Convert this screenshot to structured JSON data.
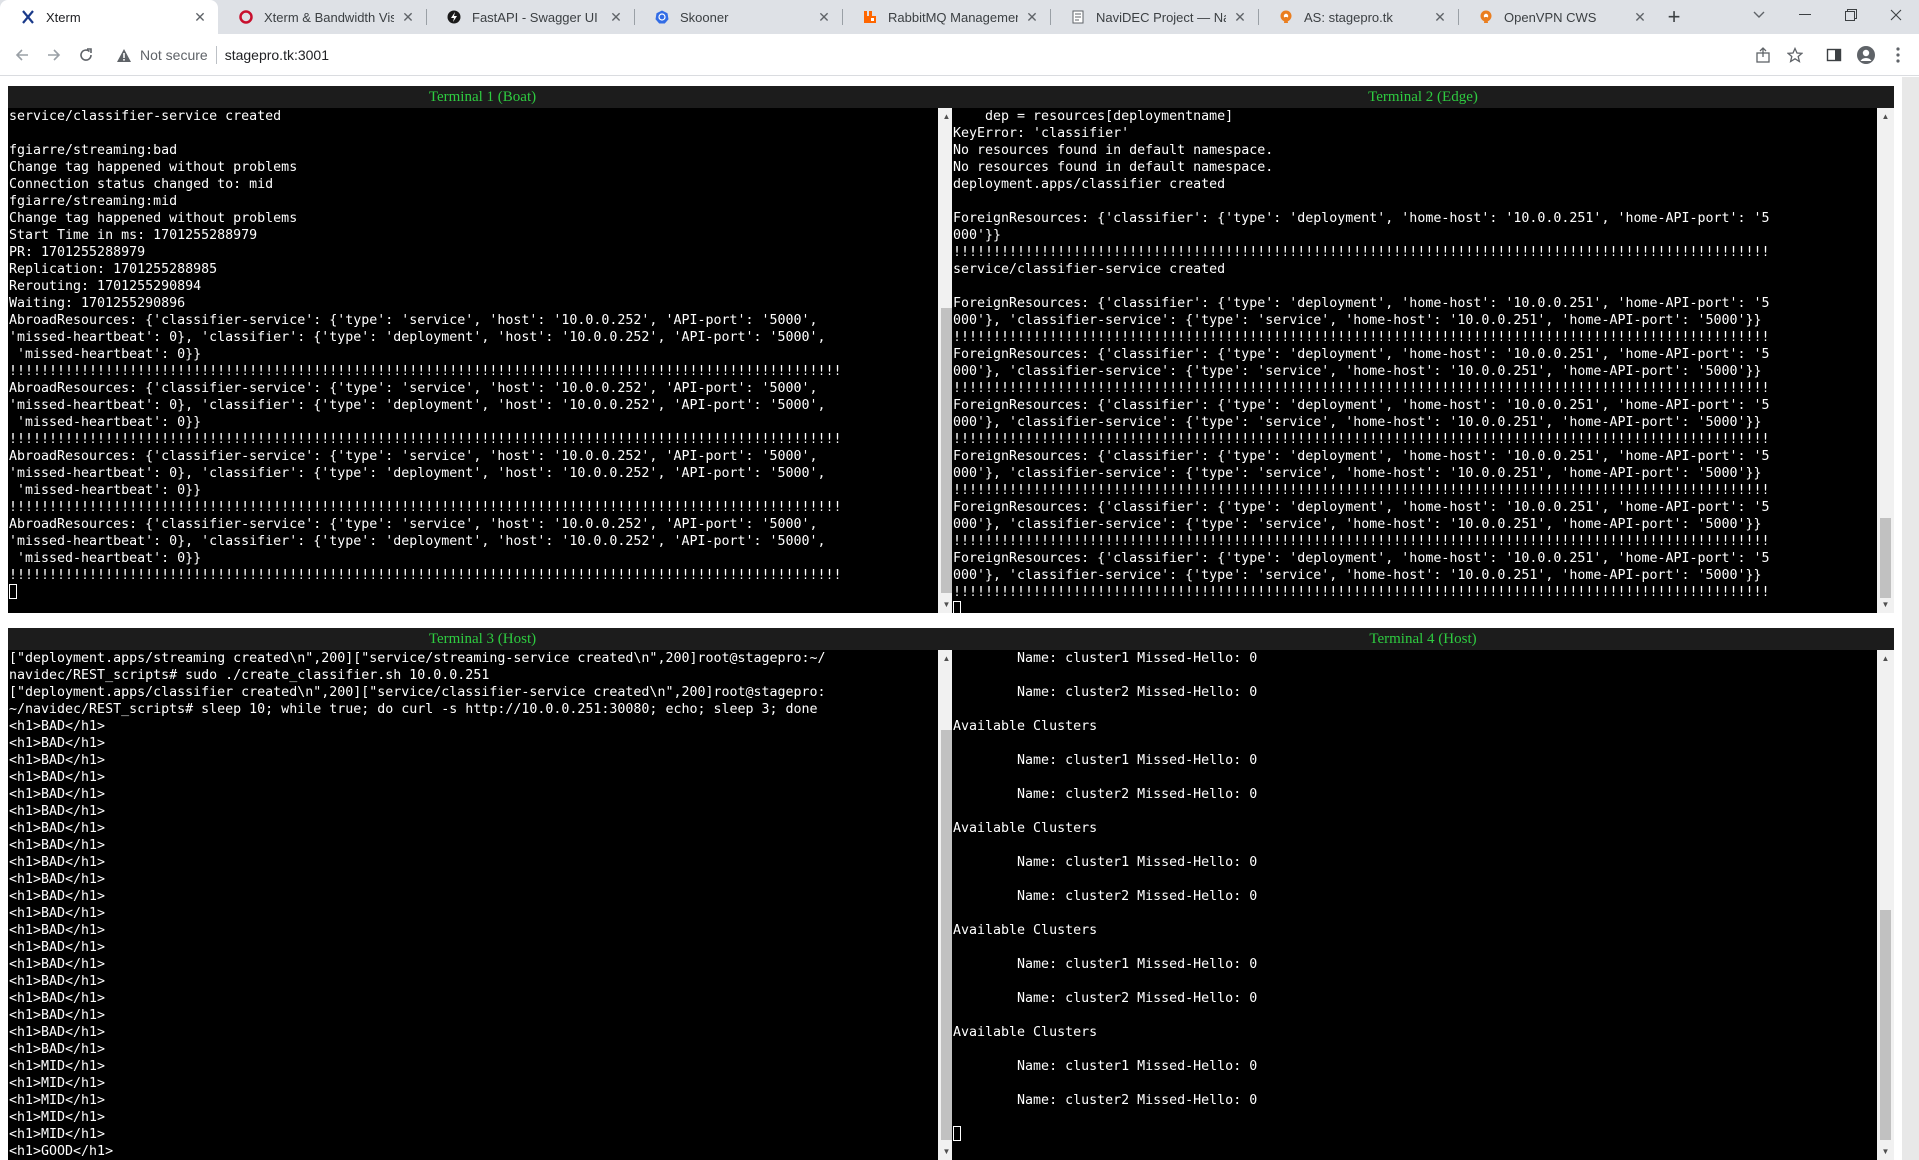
{
  "browser": {
    "tabs": [
      {
        "title": "Xterm",
        "icon": "xterm-x-icon",
        "active": true
      },
      {
        "title": "Xterm & Bandwidth Visual",
        "icon": "opera-circle-icon",
        "active": false
      },
      {
        "title": "FastAPI - Swagger UI",
        "icon": "fastapi-icon",
        "active": false
      },
      {
        "title": "Skooner",
        "icon": "kubernetes-wheel-icon",
        "active": false
      },
      {
        "title": "RabbitMQ Management",
        "icon": "rabbitmq-icon",
        "active": false
      },
      {
        "title": "NaviDEC Project — NaviD",
        "icon": "document-icon",
        "active": false
      },
      {
        "title": "AS: stagepro.tk",
        "icon": "openvpn-icon",
        "active": false
      },
      {
        "title": "OpenVPN CWS",
        "icon": "openvpn-icon",
        "active": false
      }
    ],
    "security_label": "Not secure",
    "url": "stagepro.tk:3001",
    "colors": {
      "tabstrip": "#dee1e6",
      "terminal_bg": "#000000",
      "terminal_title_fg": "#2ecc40"
    }
  },
  "terminals": {
    "t1": {
      "title": "Terminal 1 (Boat)",
      "lines": [
        "service/classifier-service created",
        "",
        "fgiarre/streaming:bad",
        "Change tag happened without problems",
        "Connection status changed to: mid",
        "fgiarre/streaming:mid",
        "Change tag happened without problems",
        "Start Time in ms: 1701255288979",
        "PR: 1701255288979",
        "Replication: 1701255288985",
        "Rerouting: 1701255290894",
        "Waiting: 1701255290896",
        "AbroadResources: {'classifier-service': {'type': 'service', 'host': '10.0.0.252', 'API-port': '5000',",
        "'missed-heartbeat': 0}, 'classifier': {'type': 'deployment', 'host': '10.0.0.252', 'API-port': '5000',",
        " 'missed-heartbeat': 0}}",
        "!!!!!!!!!!!!!!!!!!!!!!!!!!!!!!!!!!!!!!!!!!!!!!!!!!!!!!!!!!!!!!!!!!!!!!!!!!!!!!!!!!!!!!!!!!!!!!!!!!!!!!!!",
        "AbroadResources: {'classifier-service': {'type': 'service', 'host': '10.0.0.252', 'API-port': '5000',",
        "'missed-heartbeat': 0}, 'classifier': {'type': 'deployment', 'host': '10.0.0.252', 'API-port': '5000',",
        " 'missed-heartbeat': 0}}",
        "!!!!!!!!!!!!!!!!!!!!!!!!!!!!!!!!!!!!!!!!!!!!!!!!!!!!!!!!!!!!!!!!!!!!!!!!!!!!!!!!!!!!!!!!!!!!!!!!!!!!!!!!",
        "AbroadResources: {'classifier-service': {'type': 'service', 'host': '10.0.0.252', 'API-port': '5000',",
        "'missed-heartbeat': 0}, 'classifier': {'type': 'deployment', 'host': '10.0.0.252', 'API-port': '5000',",
        " 'missed-heartbeat': 0}}",
        "!!!!!!!!!!!!!!!!!!!!!!!!!!!!!!!!!!!!!!!!!!!!!!!!!!!!!!!!!!!!!!!!!!!!!!!!!!!!!!!!!!!!!!!!!!!!!!!!!!!!!!!!",
        "AbroadResources: {'classifier-service': {'type': 'service', 'host': '10.0.0.252', 'API-port': '5000',",
        "'missed-heartbeat': 0}, 'classifier': {'type': 'deployment', 'host': '10.0.0.252', 'API-port': '5000',",
        " 'missed-heartbeat': 0}}",
        "!!!!!!!!!!!!!!!!!!!!!!!!!!!!!!!!!!!!!!!!!!!!!!!!!!!!!!!!!!!!!!!!!!!!!!!!!!!!!!!!!!!!!!!!!!!!!!!!!!!!!!!!"
      ]
    },
    "t2": {
      "title": "Terminal 2 (Edge)",
      "lines": [
        "    dep = resources[deploymentname]",
        "KeyError: 'classifier'",
        "No resources found in default namespace.",
        "No resources found in default namespace.",
        "deployment.apps/classifier created",
        "",
        "ForeignResources: {'classifier': {'type': 'deployment', 'home-host': '10.0.0.251', 'home-API-port': '5",
        "000'}}",
        "!!!!!!!!!!!!!!!!!!!!!!!!!!!!!!!!!!!!!!!!!!!!!!!!!!!!!!!!!!!!!!!!!!!!!!!!!!!!!!!!!!!!!!!!!!!!!!!!!!!!!!",
        "service/classifier-service created",
        "",
        "ForeignResources: {'classifier': {'type': 'deployment', 'home-host': '10.0.0.251', 'home-API-port': '5",
        "000'}, 'classifier-service': {'type': 'service', 'home-host': '10.0.0.251', 'home-API-port': '5000'}}",
        "!!!!!!!!!!!!!!!!!!!!!!!!!!!!!!!!!!!!!!!!!!!!!!!!!!!!!!!!!!!!!!!!!!!!!!!!!!!!!!!!!!!!!!!!!!!!!!!!!!!!!!",
        "ForeignResources: {'classifier': {'type': 'deployment', 'home-host': '10.0.0.251', 'home-API-port': '5",
        "000'}, 'classifier-service': {'type': 'service', 'home-host': '10.0.0.251', 'home-API-port': '5000'}}",
        "!!!!!!!!!!!!!!!!!!!!!!!!!!!!!!!!!!!!!!!!!!!!!!!!!!!!!!!!!!!!!!!!!!!!!!!!!!!!!!!!!!!!!!!!!!!!!!!!!!!!!!",
        "ForeignResources: {'classifier': {'type': 'deployment', 'home-host': '10.0.0.251', 'home-API-port': '5",
        "000'}, 'classifier-service': {'type': 'service', 'home-host': '10.0.0.251', 'home-API-port': '5000'}}",
        "!!!!!!!!!!!!!!!!!!!!!!!!!!!!!!!!!!!!!!!!!!!!!!!!!!!!!!!!!!!!!!!!!!!!!!!!!!!!!!!!!!!!!!!!!!!!!!!!!!!!!!",
        "ForeignResources: {'classifier': {'type': 'deployment', 'home-host': '10.0.0.251', 'home-API-port': '5",
        "000'}, 'classifier-service': {'type': 'service', 'home-host': '10.0.0.251', 'home-API-port': '5000'}}",
        "!!!!!!!!!!!!!!!!!!!!!!!!!!!!!!!!!!!!!!!!!!!!!!!!!!!!!!!!!!!!!!!!!!!!!!!!!!!!!!!!!!!!!!!!!!!!!!!!!!!!!!",
        "ForeignResources: {'classifier': {'type': 'deployment', 'home-host': '10.0.0.251', 'home-API-port': '5",
        "000'}, 'classifier-service': {'type': 'service', 'home-host': '10.0.0.251', 'home-API-port': '5000'}}",
        "!!!!!!!!!!!!!!!!!!!!!!!!!!!!!!!!!!!!!!!!!!!!!!!!!!!!!!!!!!!!!!!!!!!!!!!!!!!!!!!!!!!!!!!!!!!!!!!!!!!!!!",
        "ForeignResources: {'classifier': {'type': 'deployment', 'home-host': '10.0.0.251', 'home-API-port': '5",
        "000'}, 'classifier-service': {'type': 'service', 'home-host': '10.0.0.251', 'home-API-port': '5000'}}",
        "!!!!!!!!!!!!!!!!!!!!!!!!!!!!!!!!!!!!!!!!!!!!!!!!!!!!!!!!!!!!!!!!!!!!!!!!!!!!!!!!!!!!!!!!!!!!!!!!!!!!!!"
      ]
    },
    "t3": {
      "title": "Terminal 3 (Host)",
      "lines": [
        "[\"deployment.apps/streaming created\\n\",200][\"service/streaming-service created\\n\",200]root@stagepro:~/",
        "navidec/REST_scripts# sudo ./create_classifier.sh 10.0.0.251",
        "[\"deployment.apps/classifier created\\n\",200][\"service/classifier-service created\\n\",200]root@stagepro:",
        "~/navidec/REST_scripts# sleep 10; while true; do curl -s http://10.0.0.251:30080; echo; sleep 3; done",
        "<h1>BAD</h1>",
        "<h1>BAD</h1>",
        "<h1>BAD</h1>",
        "<h1>BAD</h1>",
        "<h1>BAD</h1>",
        "<h1>BAD</h1>",
        "<h1>BAD</h1>",
        "<h1>BAD</h1>",
        "<h1>BAD</h1>",
        "<h1>BAD</h1>",
        "<h1>BAD</h1>",
        "<h1>BAD</h1>",
        "<h1>BAD</h1>",
        "<h1>BAD</h1>",
        "<h1>BAD</h1>",
        "<h1>BAD</h1>",
        "<h1>BAD</h1>",
        "<h1>BAD</h1>",
        "<h1>BAD</h1>",
        "<h1>BAD</h1>",
        "<h1>MID</h1>",
        "<h1>MID</h1>",
        "<h1>MID</h1>",
        "<h1>MID</h1>",
        "<h1>MID</h1>",
        "<h1>GOOD</h1>"
      ]
    },
    "t4": {
      "title": "Terminal 4 (Host)",
      "lines": [
        "        Name: cluster1 Missed-Hello: 0",
        "",
        "        Name: cluster2 Missed-Hello: 0",
        "",
        "Available Clusters",
        "",
        "        Name: cluster1 Missed-Hello: 0",
        "",
        "        Name: cluster2 Missed-Hello: 0",
        "",
        "Available Clusters",
        "",
        "        Name: cluster1 Missed-Hello: 0",
        "",
        "        Name: cluster2 Missed-Hello: 0",
        "",
        "Available Clusters",
        "",
        "        Name: cluster1 Missed-Hello: 0",
        "",
        "        Name: cluster2 Missed-Hello: 0",
        "",
        "Available Clusters",
        "",
        "        Name: cluster1 Missed-Hello: 0",
        "",
        "        Name: cluster2 Missed-Hello: 0",
        ""
      ]
    }
  }
}
